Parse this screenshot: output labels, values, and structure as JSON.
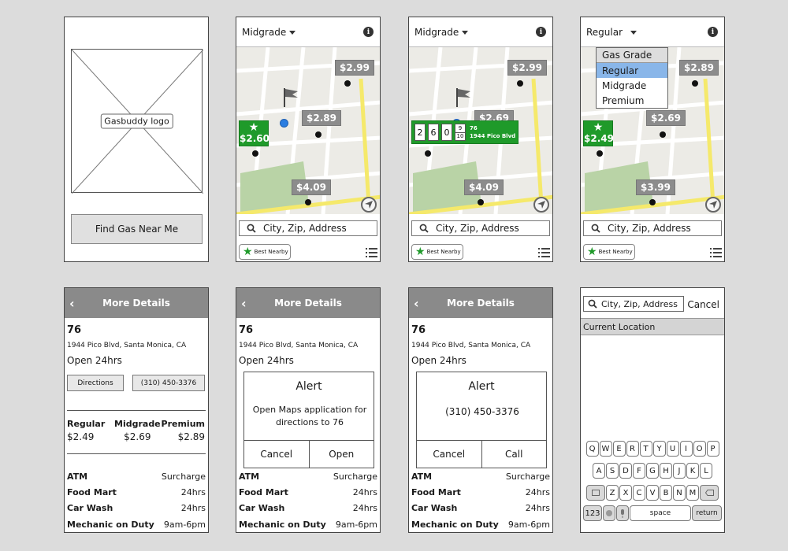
{
  "splash": {
    "logo_label": "Gasbuddy logo",
    "find_button": "Find Gas Near Me"
  },
  "map_screens": [
    {
      "grade": "Midgrade",
      "prices": [
        "$2.99",
        "$2.89",
        "$4.09"
      ],
      "best_price": "$2.60",
      "search_placeholder": "City, Zip, Address",
      "best_nearby": "Best Nearby"
    },
    {
      "grade": "Midgrade",
      "prices": [
        "$2.99",
        "$2.69",
        "$4.09"
      ],
      "search_placeholder": "City, Zip, Address",
      "best_nearby": "Best Nearby",
      "callout": {
        "digits": [
          "2",
          "6",
          "0"
        ],
        "fraction": [
          "9",
          "10"
        ],
        "station": "76",
        "address": "1944 Pico Blvd"
      }
    },
    {
      "grade": "Regular",
      "prices": [
        "$2.89",
        "$2.69",
        "$3.99"
      ],
      "best_price": "$2.49",
      "search_placeholder": "City, Zip, Address",
      "best_nearby": "Best Nearby",
      "dropdown": {
        "header": "Gas Grade",
        "options": [
          "Regular",
          "Midgrade",
          "Premium"
        ],
        "selected": "Regular"
      }
    }
  ],
  "details": {
    "title": "More Details",
    "name": "76",
    "address": "1944 Pico Blvd, Santa Monica, CA",
    "hours": "Open 24hrs",
    "directions_button": "Directions",
    "phone_button": "(310) 450-3376",
    "grades": [
      {
        "label": "Regular",
        "price": "$2.49"
      },
      {
        "label": "Midgrade",
        "price": "$2.69"
      },
      {
        "label": "Premium",
        "price": "$2.89"
      }
    ],
    "amenities": [
      {
        "name": "ATM",
        "value": "Surcharge"
      },
      {
        "name": "Food Mart",
        "value": "24hrs"
      },
      {
        "name": "Car Wash",
        "value": "24hrs"
      },
      {
        "name": "Mechanic on Duty",
        "value": "9am-6pm"
      }
    ]
  },
  "alert_maps": {
    "title": "Alert",
    "message": "Open Maps application for directions to 76",
    "cancel": "Cancel",
    "confirm": "Open"
  },
  "alert_call": {
    "title": "Alert",
    "message": "(310) 450-3376",
    "cancel": "Cancel",
    "confirm": "Call"
  },
  "search_screen": {
    "input_value": "City, Zip, Address",
    "cancel": "Cancel",
    "current_location": "Current Location",
    "keyboard": {
      "row1": [
        "Q",
        "W",
        "E",
        "R",
        "T",
        "Y",
        "U",
        "I",
        "O",
        "P"
      ],
      "row2": [
        "A",
        "S",
        "D",
        "F",
        "G",
        "H",
        "J",
        "K",
        "L"
      ],
      "row3": [
        "Z",
        "X",
        "C",
        "V",
        "B",
        "N",
        "M"
      ],
      "num_key": "123",
      "space_key": "space",
      "return_key": "return"
    }
  },
  "colors": {
    "background": "#dcdcdc",
    "header_gray": "#8a8a8a",
    "price_pin": "#8c8c8c",
    "best_green": "#1f9a2a",
    "selected_blue": "#89b6e9",
    "road_yellow": "#f5e96b",
    "park_green": "#b9d3a6"
  }
}
